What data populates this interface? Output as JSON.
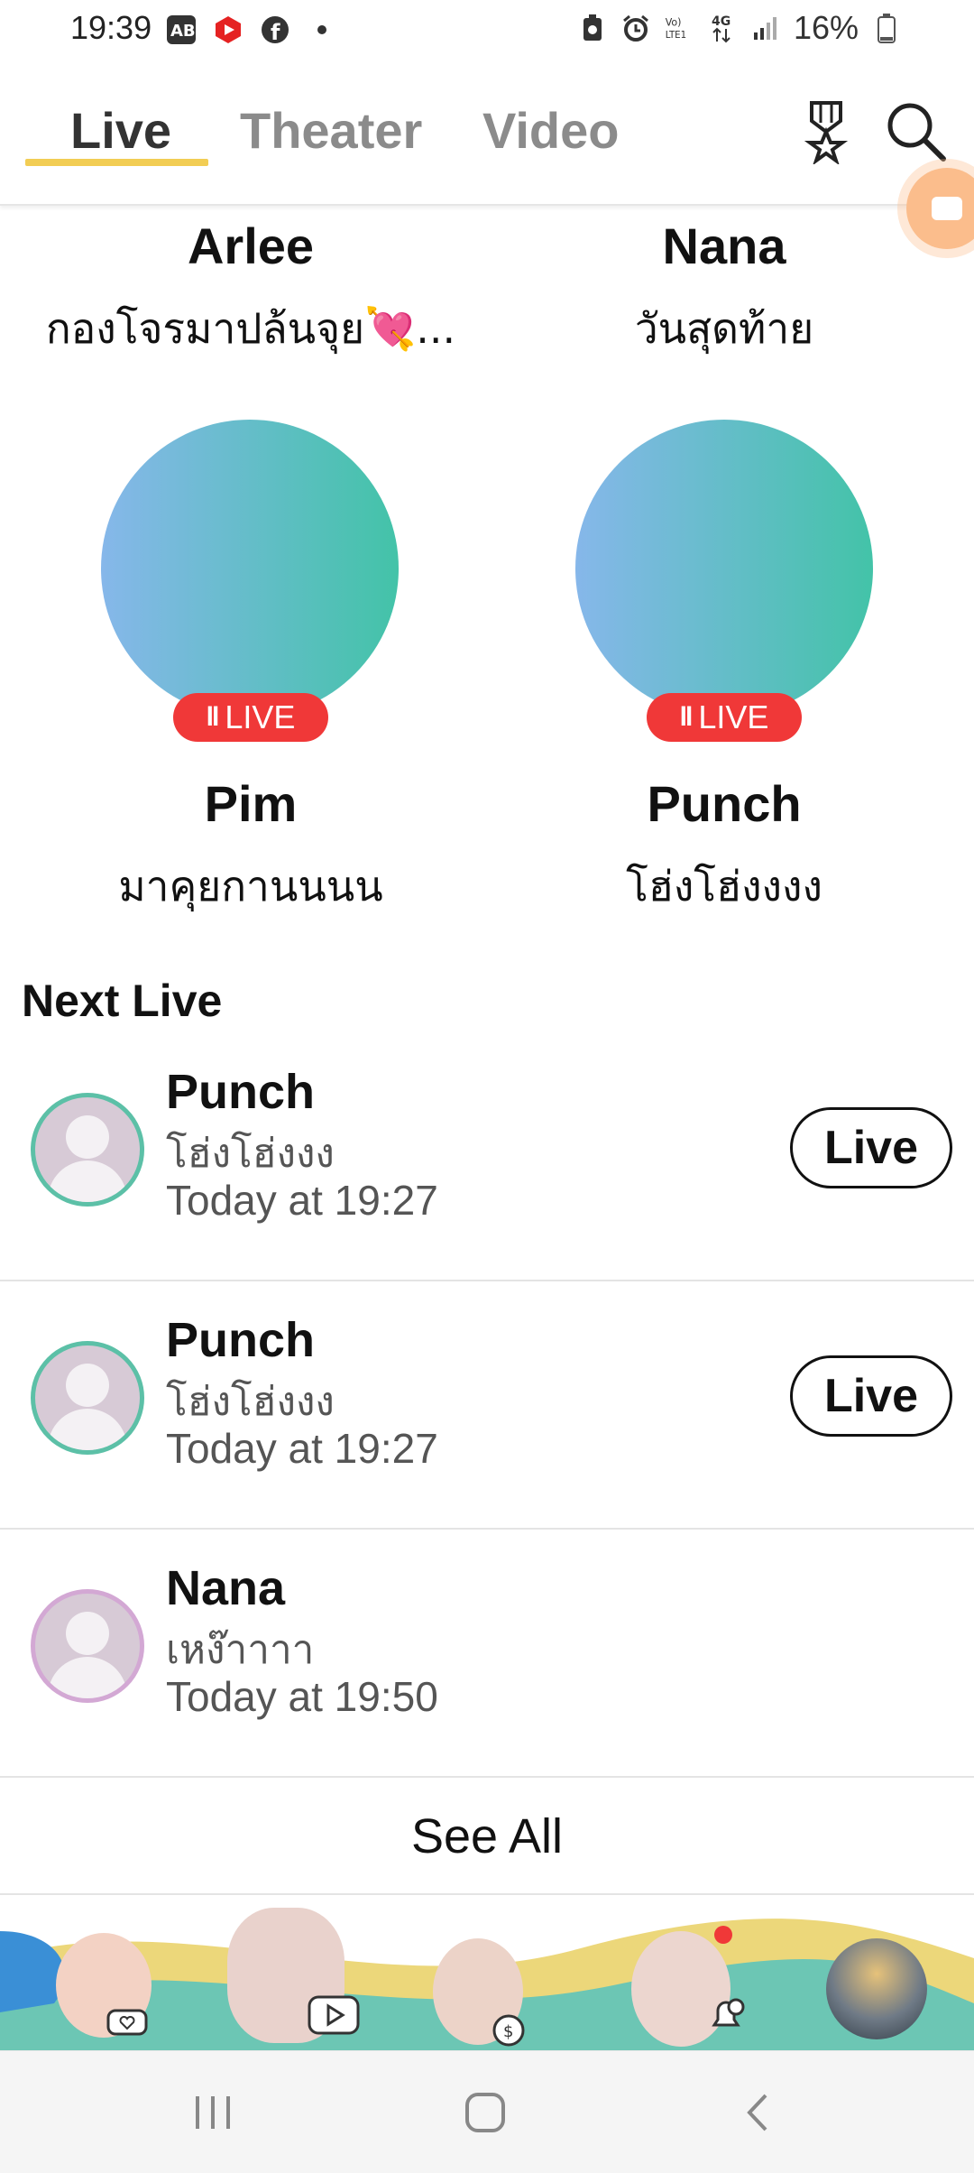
{
  "status_bar": {
    "time": "19:39",
    "battery": "16%",
    "left_icons": [
      "ab-app-icon",
      "youtube-icon",
      "facebook-icon",
      "dot-icon"
    ],
    "right_icons": [
      "battery-saver-icon",
      "alarm-icon",
      "volte-icon",
      "4g-icon",
      "signal-icon",
      "battery-icon"
    ]
  },
  "header": {
    "tabs": [
      {
        "label": "Live",
        "active": true
      },
      {
        "label": "Theater",
        "active": false
      },
      {
        "label": "Video",
        "active": false
      }
    ],
    "accent_color": "#f2cd54"
  },
  "top_cards": [
    {
      "name": "Arlee",
      "subtitle": "กองโจรมาปล้นจุย💘..."
    },
    {
      "name": "Nana",
      "subtitle": "วันสุดท้าย"
    }
  ],
  "live_cards": [
    {
      "name": "Pim",
      "subtitle": "มาคุยกานนนน",
      "badge": "LIVE",
      "badge_icon": "ll"
    },
    {
      "name": "Punch",
      "subtitle": "โฮ่งโฮ่งงงง",
      "badge": "LIVE",
      "badge_icon": "ll"
    }
  ],
  "next_live": {
    "title": "Next Live",
    "items": [
      {
        "name": "Punch",
        "subtitle": "โฮ่งโฮ่งงง",
        "time": "Today at 19:27",
        "button": "Live"
      },
      {
        "name": "Punch",
        "subtitle": "โฮ่งโฮ่งงง",
        "time": "Today at 19:27",
        "button": "Live"
      },
      {
        "name": "Nana",
        "subtitle": "เหง๊าาาา",
        "time": "Today at 19:50",
        "button": ""
      }
    ],
    "see_all": "See All"
  },
  "colors": {
    "live_red": "#f03838",
    "gradient_start": "#86b7ea",
    "gradient_end": "#43c3a8",
    "ring_green": "#5cc0a7",
    "ring_pink": "#d3a8d4"
  }
}
